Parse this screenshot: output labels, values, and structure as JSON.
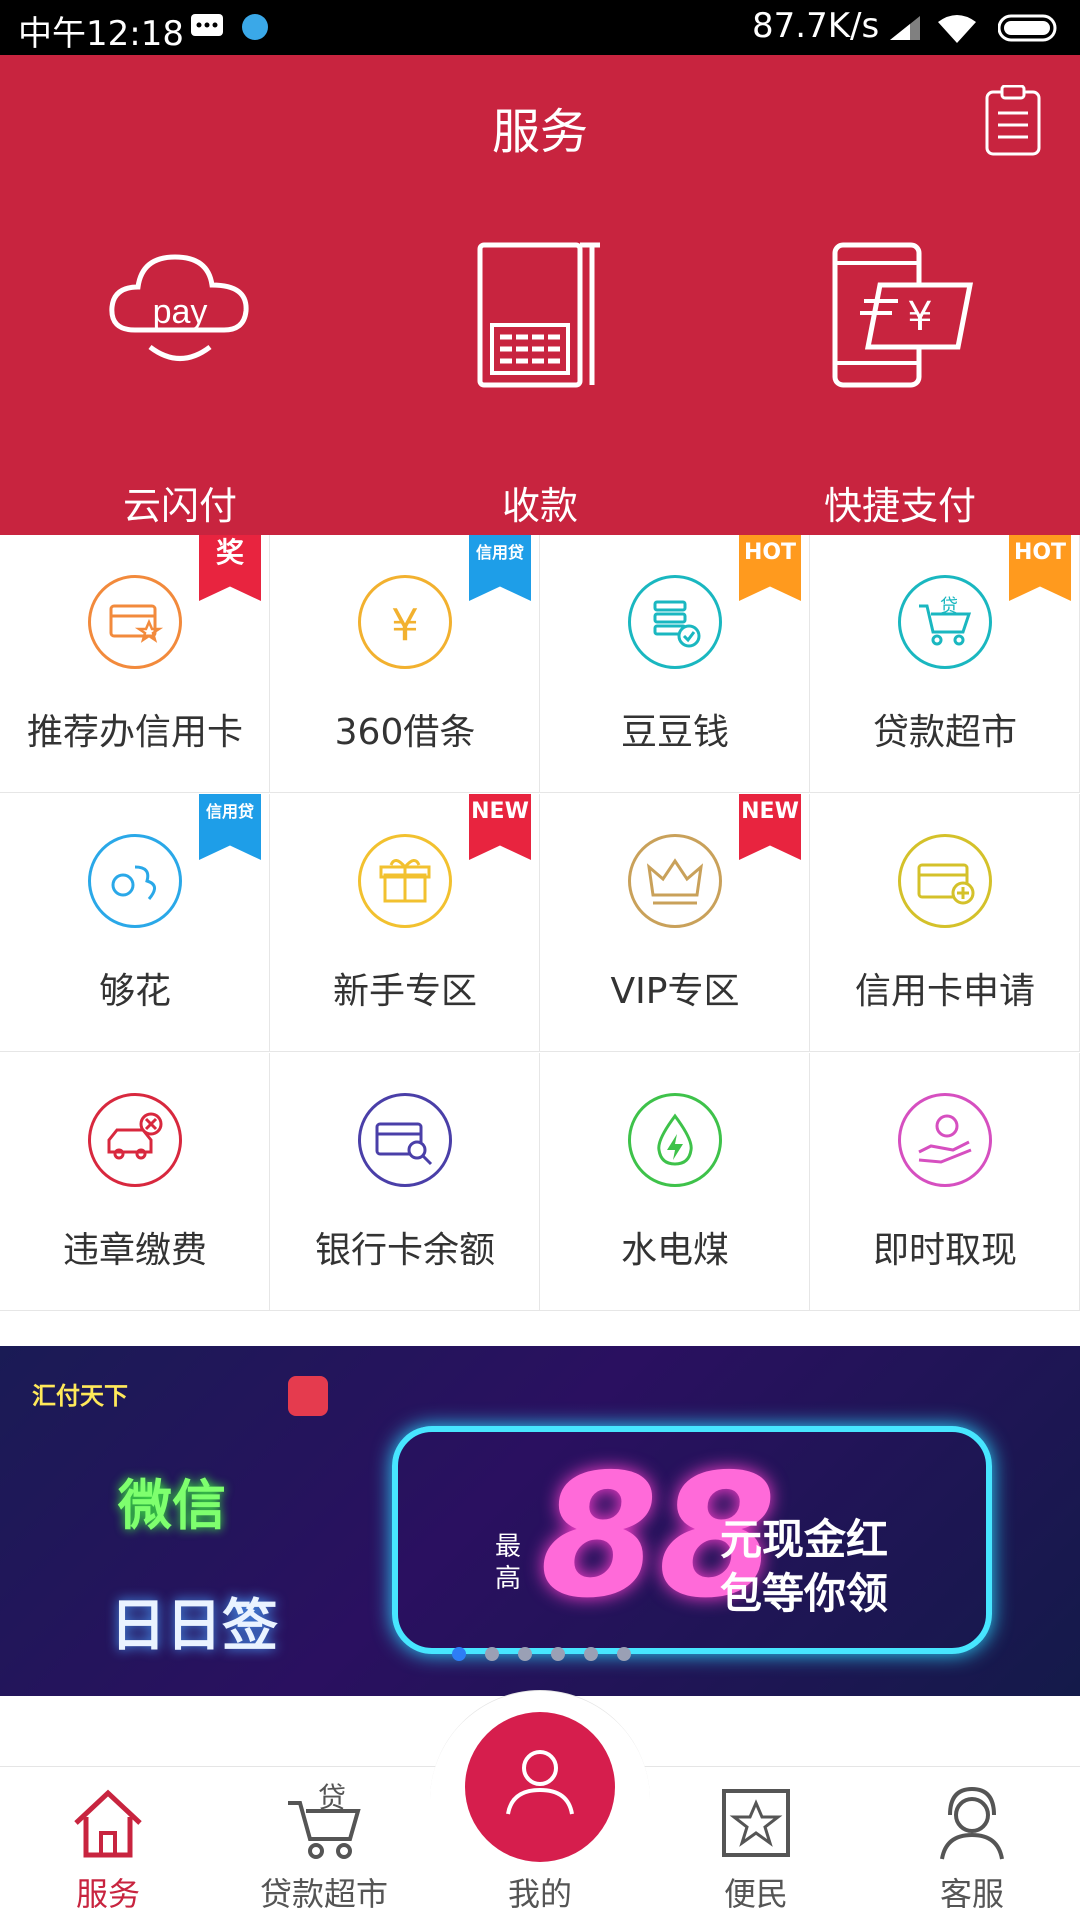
{
  "status_bar": {
    "time": "中午12:18",
    "net_speed": "87.7K/s"
  },
  "header": {
    "title": "服务"
  },
  "top_services": [
    {
      "label": "云闪付",
      "icon": "pay-cloud-icon"
    },
    {
      "label": "收款",
      "icon": "pos-terminal-icon"
    },
    {
      "label": "快捷支付",
      "icon": "phone-payment-icon"
    }
  ],
  "grid_items": [
    {
      "label": "推荐办信用卡",
      "badge": "奖",
      "icon": "card-star-icon",
      "color": "#f28a3c",
      "badge_color": "#e8243f"
    },
    {
      "label": "360借条",
      "badge": "信用贷",
      "icon": "yen-coin-icon",
      "color": "#f2b12f",
      "badge_color": "#1e9ee8"
    },
    {
      "label": "豆豆钱",
      "badge": "HOT",
      "icon": "coin-stack-icon",
      "color": "#1ab7c0",
      "badge_color": "#ff9a1e"
    },
    {
      "label": "贷款超市",
      "badge": "HOT",
      "icon": "loan-cart-icon",
      "color": "#1ab7c0",
      "badge_color": "#ff9a1e"
    },
    {
      "label": "够花",
      "badge": "信用贷",
      "icon": "gouhua-icon",
      "color": "#2aa8e8",
      "badge_color": "#1e9ee8"
    },
    {
      "label": "新手专区",
      "badge": "NEW",
      "icon": "gift-icon",
      "color": "#f2c12f",
      "badge_color": "#e8243f"
    },
    {
      "label": "VIP专区",
      "badge": "NEW",
      "icon": "crown-icon",
      "color": "#c9a15a",
      "badge_color": "#e8243f"
    },
    {
      "label": "信用卡申请",
      "badge": "",
      "icon": "card-add-icon",
      "color": "#d4c12a",
      "badge_color": ""
    },
    {
      "label": "违章缴费",
      "badge": "",
      "icon": "car-violation-icon",
      "color": "#d8283e",
      "badge_color": ""
    },
    {
      "label": "银行卡余额",
      "badge": "",
      "icon": "card-search-icon",
      "color": "#4a3fa8",
      "badge_color": ""
    },
    {
      "label": "水电煤",
      "badge": "",
      "icon": "water-drop-icon",
      "color": "#3ec24a",
      "badge_color": ""
    },
    {
      "label": "即时取现",
      "badge": "",
      "icon": "cash-hand-icon",
      "color": "#d64fc0",
      "badge_color": ""
    }
  ],
  "banner": {
    "brand": "汇付天下",
    "line1": "微信",
    "line2": "日日签",
    "prefix": "最高",
    "amount": "88",
    "promo_line1": "元现金红",
    "promo_line2": "包等你领",
    "slide_count": 6,
    "active_slide": 1
  },
  "tab_bar": {
    "tabs": [
      {
        "label": "服务",
        "icon": "home-icon",
        "active": true
      },
      {
        "label": "贷款超市",
        "icon": "loan-cart-icon",
        "active": false
      },
      {
        "label": "我的",
        "icon": "user-icon",
        "active": false
      },
      {
        "label": "便民",
        "icon": "star-frame-icon",
        "active": false
      },
      {
        "label": "客服",
        "icon": "headset-agent-icon",
        "active": false
      }
    ]
  },
  "colors": {
    "brand_red": "#c8243f",
    "center_button": "#d61e4d",
    "active_tab": "#c8243f"
  }
}
